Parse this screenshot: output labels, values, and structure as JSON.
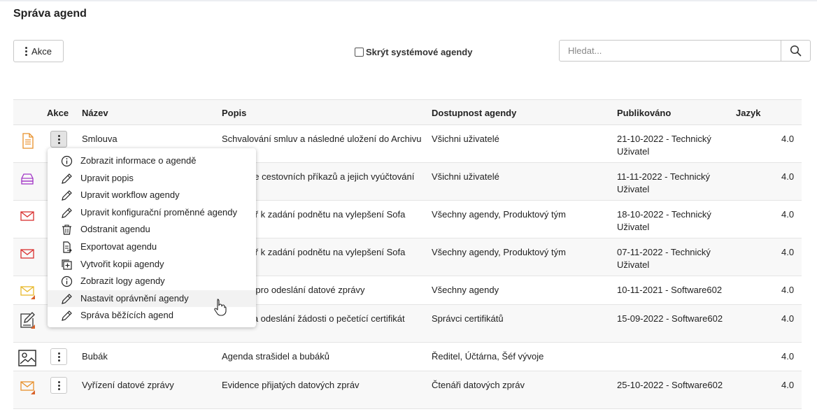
{
  "page": {
    "title": "Správa agend"
  },
  "toolbar": {
    "akce_label": "Akce",
    "hide_system_label": "Skrýt systémové agendy",
    "search_placeholder": "Hledat..."
  },
  "table": {
    "columns": {
      "akce": "Akce",
      "nazev": "Název",
      "popis": "Popis",
      "dostupnost": "Dostupnost agendy",
      "publikovano": "Publikováno",
      "jazyk": "Jazyk"
    },
    "rows": [
      {
        "icon": "document-icon",
        "nazev": "Smlouva",
        "popis": "Schvalování smluv a následné uložení do Archivu",
        "dostupnost": "Všichni uživatelé",
        "publikovano": "21-10-2022 - Technický Uživatel",
        "jazyk": "4.0"
      },
      {
        "icon": "car-icon",
        "nazev": "",
        "popis": "Evidence cestovních příkazů a jejich vyúčtování",
        "dostupnost": "Všichni uživatelé",
        "publikovano": "11-11-2022 - Technický Uživatel",
        "jazyk": "4.0"
      },
      {
        "icon": "mail-icon",
        "nazev": "",
        "popis": "Formulář k zadání podnětu na vylepšení Sofa",
        "dostupnost": "Všechny agendy, Produktový tým",
        "publikovano": "18-10-2022 - Technický Uživatel",
        "jazyk": "4.0"
      },
      {
        "icon": "mail-icon",
        "nazev": "",
        "popis": "Formulář k zadání podnětu na vylepšení Sofa",
        "dostupnost": "Všechny agendy, Produktový tým",
        "publikovano": "07-11-2022 - Technický Uživatel",
        "jazyk": "4.0"
      },
      {
        "icon": "mail-outgoing-icon",
        "nazev": "",
        "popis": "Agenda pro odeslání datové zprávy",
        "dostupnost": "Všechny agendy",
        "publikovano": "10-11-2021 - Software602",
        "jazyk": "4.0"
      },
      {
        "icon": "edit-document-icon",
        "nazev": "",
        "popis": "Podání a odeslání žádosti o pečetící certifikát",
        "dostupnost": "Správci certifikátů",
        "publikovano": "15-09-2022 - Software602",
        "jazyk": "4.0"
      },
      {
        "icon": "image-icon",
        "nazev": "Bubák",
        "popis": "Agenda strašidel a bubáků",
        "dostupnost": "Ředitel, Účtárna, Šéf vývoje",
        "publikovano": "",
        "jazyk": "4.0"
      },
      {
        "icon": "mail-incoming-icon",
        "nazev": "Vyřízení datové zprávy",
        "popis": "Evidence přijatých datových zpráv",
        "dostupnost": "Čtenáři datových zpráv",
        "publikovano": "25-10-2022 - Software602",
        "jazyk": "4.0"
      }
    ]
  },
  "context_menu": {
    "items": [
      {
        "icon": "info-icon",
        "label": "Zobrazit informace o agendě"
      },
      {
        "icon": "pencil-icon",
        "label": "Upravit popis"
      },
      {
        "icon": "pencil-icon",
        "label": "Upravit workflow agendy"
      },
      {
        "icon": "pencil-icon",
        "label": "Upravit konfigurační proměnné agendy"
      },
      {
        "icon": "trash-icon",
        "label": "Odstranit agendu"
      },
      {
        "icon": "export-icon",
        "label": "Exportovat agendu"
      },
      {
        "icon": "copy-icon",
        "label": "Vytvořit kopii agendy"
      },
      {
        "icon": "info-icon",
        "label": "Zobrazit logy agendy"
      },
      {
        "icon": "pencil-icon",
        "label": "Nastavit oprávnění agendy"
      },
      {
        "icon": "pencil-icon",
        "label": "Správa běžících agend"
      }
    ]
  },
  "colors": {
    "accent_orange": "#e8902a",
    "mail_red": "#d9302f",
    "car_purple": "#a236c6"
  }
}
